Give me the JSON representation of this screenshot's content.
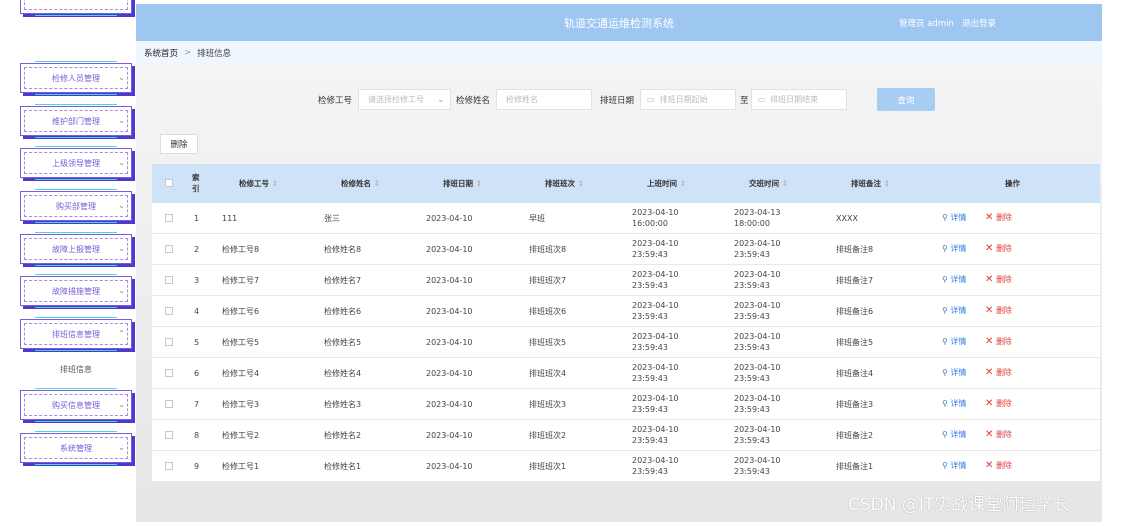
{
  "header": {
    "title": "轨道交通运维检测系统",
    "user_label": "管理员 admin",
    "logout": "退出登录"
  },
  "breadcrumb": {
    "home": "系统首页",
    "separator": ">",
    "current": "排班信息"
  },
  "sidebar": {
    "items": [
      {
        "label": "检修人员管理"
      },
      {
        "label": "维护部门管理"
      },
      {
        "label": "上级领导管理"
      },
      {
        "label": "购买部管理"
      },
      {
        "label": "故障上报管理"
      },
      {
        "label": "故障措施管理"
      },
      {
        "label": "排班信息管理"
      },
      {
        "label": "购买信息管理"
      },
      {
        "label": "系统管理"
      }
    ],
    "sub_item": "排班信息"
  },
  "search": {
    "worker_no_label": "检修工号",
    "worker_no_placeholder": "请选择检修工号",
    "worker_name_label": "检修姓名",
    "worker_name_placeholder": "检修姓名",
    "date_label": "排班日期",
    "date_start_placeholder": "排班日期起始",
    "date_to": "至",
    "date_end_placeholder": "排班日期结束",
    "query_button": "查询"
  },
  "toolbar": {
    "delete_button": "删除"
  },
  "table": {
    "columns": [
      "索引",
      "检修工号",
      "检修姓名",
      "排班日期",
      "排班班次",
      "上班时间",
      "交班时间",
      "排班备注",
      "操作"
    ],
    "detail_label": "详情",
    "delete_label": "删除",
    "rows": [
      {
        "idx": "1",
        "no": "111",
        "name": "张三",
        "date": "2023-04-10",
        "shift": "早班",
        "start": "2023-04-10 16:00:00",
        "end": "2023-04-13 18:00:00",
        "remark": "XXXX"
      },
      {
        "idx": "2",
        "no": "检修工号8",
        "name": "检修姓名8",
        "date": "2023-04-10",
        "shift": "排班班次8",
        "start": "2023-04-10 23:59:43",
        "end": "2023-04-10 23:59:43",
        "remark": "排班备注8"
      },
      {
        "idx": "3",
        "no": "检修工号7",
        "name": "检修姓名7",
        "date": "2023-04-10",
        "shift": "排班班次7",
        "start": "2023-04-10 23:59:43",
        "end": "2023-04-10 23:59:43",
        "remark": "排班备注7"
      },
      {
        "idx": "4",
        "no": "检修工号6",
        "name": "检修姓名6",
        "date": "2023-04-10",
        "shift": "排班班次6",
        "start": "2023-04-10 23:59:43",
        "end": "2023-04-10 23:59:43",
        "remark": "排班备注6"
      },
      {
        "idx": "5",
        "no": "检修工号5",
        "name": "检修姓名5",
        "date": "2023-04-10",
        "shift": "排班班次5",
        "start": "2023-04-10 23:59:43",
        "end": "2023-04-10 23:59:43",
        "remark": "排班备注5"
      },
      {
        "idx": "6",
        "no": "检修工号4",
        "name": "检修姓名4",
        "date": "2023-04-10",
        "shift": "排班班次4",
        "start": "2023-04-10 23:59:43",
        "end": "2023-04-10 23:59:43",
        "remark": "排班备注4"
      },
      {
        "idx": "7",
        "no": "检修工号3",
        "name": "检修姓名3",
        "date": "2023-04-10",
        "shift": "排班班次3",
        "start": "2023-04-10 23:59:43",
        "end": "2023-04-10 23:59:43",
        "remark": "排班备注3"
      },
      {
        "idx": "8",
        "no": "检修工号2",
        "name": "检修姓名2",
        "date": "2023-04-10",
        "shift": "排班班次2",
        "start": "2023-04-10 23:59:43",
        "end": "2023-04-10 23:59:43",
        "remark": "排班备注2"
      },
      {
        "idx": "9",
        "no": "检修工号1",
        "name": "检修姓名1",
        "date": "2023-04-10",
        "shift": "排班班次1",
        "start": "2023-04-10 23:59:43",
        "end": "2023-04-10 23:59:43",
        "remark": "排班备注1"
      }
    ]
  },
  "watermark": "CSDN @IT实战课堂阿瑄学长",
  "colors": {
    "header": "#9dc6f1",
    "table_head": "#cfe3f8",
    "menu_border": "#7b5cd6",
    "detail": "#2f7ae5",
    "delete": "#e23b3b"
  },
  "icons": {
    "detail": "search-icon",
    "delete": "close-icon",
    "chevron": "chevron-down-icon",
    "calendar": "calendar-icon"
  }
}
